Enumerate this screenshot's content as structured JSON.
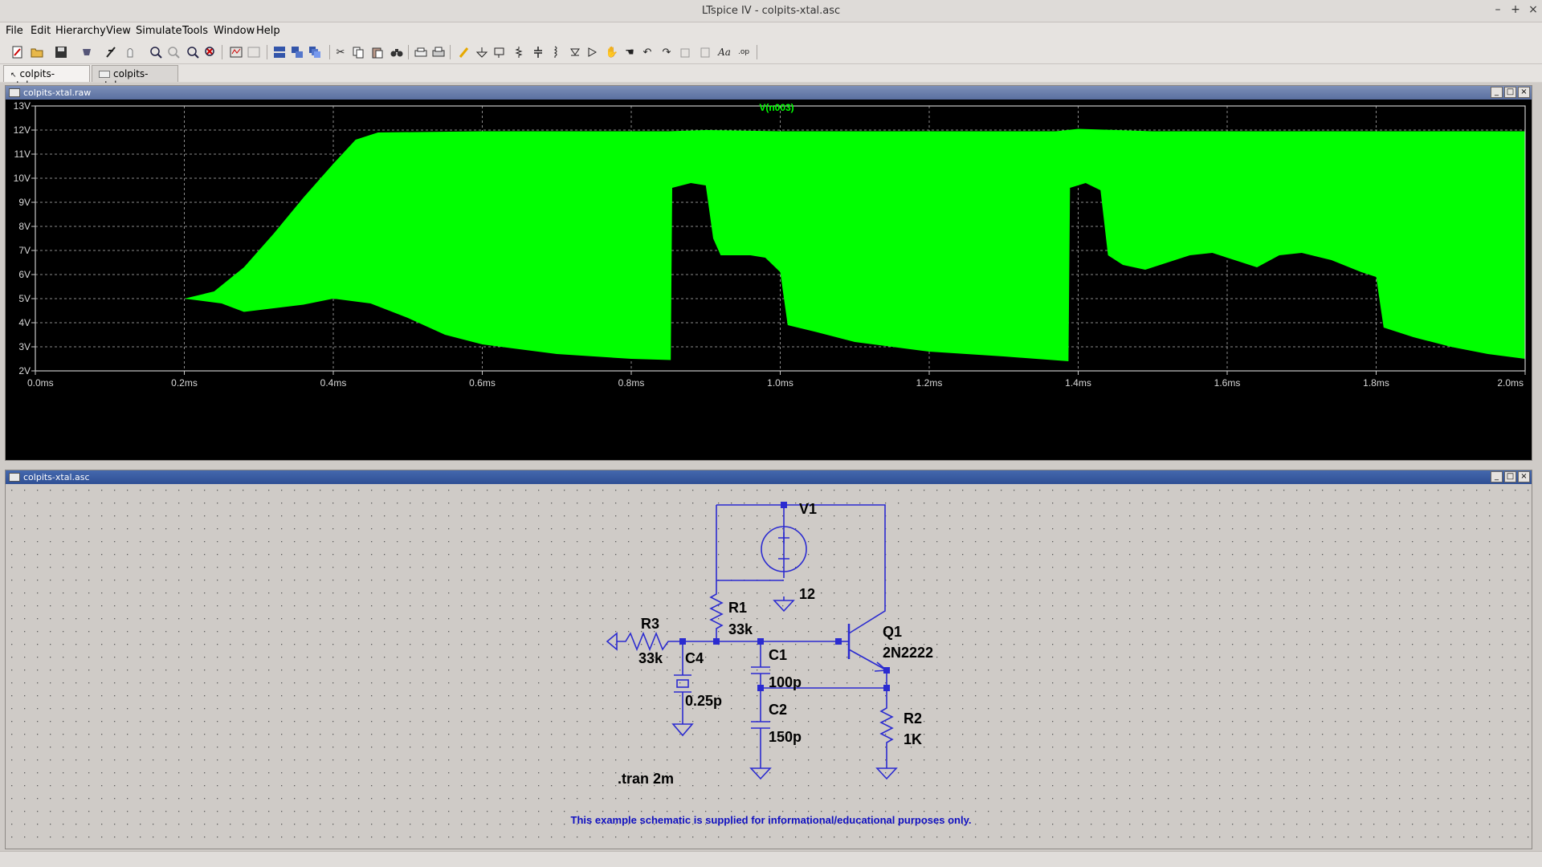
{
  "window": {
    "title": "LTspice IV - colpits-xtal.asc",
    "minimize": "–",
    "maximize": "+",
    "close": "×"
  },
  "menu": [
    "File",
    "Edit",
    "Hierarchy",
    "View",
    "Simulate",
    "Tools",
    "Window",
    "Help"
  ],
  "toolbar_icons": [
    "new-schematic-icon",
    "open-icon",
    "save-icon",
    "control-panel-icon",
    "run-icon",
    "halt-icon",
    "zoom-in-icon",
    "zoom-full-icon",
    "zoom-out-icon",
    "zoom-cancel-icon",
    "autorange-icon",
    "tile-horizontal-icon",
    "tile-vertical-icon",
    "cascade-icon",
    "cut-icon",
    "copy-icon",
    "paste-icon",
    "find-icon",
    "print-setup-icon",
    "print-icon",
    "wire-icon",
    "ground-icon",
    "label-net-icon",
    "resistor-icon",
    "capacitor-icon",
    "inductor-icon",
    "diode-icon",
    "component-icon",
    "move-icon",
    "drag-icon",
    "undo-icon",
    "redo-icon",
    "rotate-icon",
    "mirror-icon",
    "text-icon",
    "spice-directive-icon"
  ],
  "tabs": [
    {
      "label": "colpits-xtal.asc",
      "active": true
    },
    {
      "label": "colpits-xtal.raw",
      "active": false
    }
  ],
  "waveform_window": {
    "title": "colpits-xtal.raw",
    "trace_name": "V(n003)",
    "trace_color": "#00ff00",
    "background": "#000000",
    "button_labels": [
      "_",
      "□",
      "×"
    ]
  },
  "chart_data": {
    "type": "area",
    "title": "V(n003)",
    "xlabel": "",
    "ylabel": "",
    "xlim": [
      0.0,
      2.0
    ],
    "ylim": [
      2,
      13
    ],
    "x_ticks": [
      "0.0ms",
      "0.2ms",
      "0.4ms",
      "0.6ms",
      "0.8ms",
      "1.0ms",
      "1.2ms",
      "1.4ms",
      "1.6ms",
      "1.8ms",
      "2.0ms"
    ],
    "y_ticks": [
      "2V",
      "3V",
      "4V",
      "5V",
      "6V",
      "7V",
      "8V",
      "9V",
      "10V",
      "11V",
      "12V",
      "13V"
    ],
    "grid": true,
    "series": [
      {
        "name": "V(n003)",
        "x_ms": [
          0.0,
          0.2,
          0.24,
          0.28,
          0.32,
          0.36,
          0.4,
          0.43,
          0.46,
          0.6,
          0.8,
          0.85,
          0.9,
          1.0,
          1.2,
          1.37,
          1.4,
          1.5,
          1.7,
          1.8,
          2.0
        ],
        "upper_V": [
          5.0,
          5.0,
          5.3,
          6.3,
          7.7,
          9.2,
          10.6,
          11.6,
          11.9,
          11.95,
          11.95,
          11.95,
          12.0,
          11.95,
          11.95,
          11.95,
          12.05,
          11.95,
          11.95,
          11.95,
          11.95
        ],
        "lower_x_ms": [
          0.0,
          0.2,
          0.25,
          0.28,
          0.32,
          0.36,
          0.4,
          0.45,
          0.5,
          0.55,
          0.6,
          0.7,
          0.8,
          0.853,
          0.855,
          0.88,
          0.9,
          0.91,
          0.92,
          0.93,
          0.96,
          0.98,
          1.0,
          1.01,
          1.05,
          1.1,
          1.2,
          1.3,
          1.387,
          1.389,
          1.41,
          1.43,
          1.44,
          1.46,
          1.49,
          1.52,
          1.55,
          1.58,
          1.61,
          1.64,
          1.67,
          1.7,
          1.74,
          1.78,
          1.8,
          1.81,
          1.85,
          1.9,
          1.95,
          2.0
        ],
        "lower_V": [
          5.0,
          5.0,
          4.8,
          4.45,
          4.6,
          4.75,
          5.0,
          4.8,
          4.2,
          3.5,
          3.1,
          2.7,
          2.5,
          2.45,
          9.6,
          9.8,
          9.7,
          7.5,
          6.8,
          6.8,
          6.8,
          6.7,
          6.1,
          3.9,
          3.6,
          3.2,
          2.8,
          2.6,
          2.4,
          9.6,
          9.8,
          9.5,
          6.8,
          6.4,
          6.2,
          6.5,
          6.8,
          6.9,
          6.6,
          6.3,
          6.8,
          6.9,
          6.6,
          6.1,
          5.9,
          3.8,
          3.4,
          3.0,
          2.7,
          2.5
        ]
      }
    ]
  },
  "schematic_window": {
    "title": "colpits-xtal.asc",
    "wire_color": "#2b2bd0",
    "components": {
      "v1": {
        "name": "V1",
        "value": "12"
      },
      "r1": {
        "name": "R1",
        "value": "33k"
      },
      "r2": {
        "name": "R2",
        "value": "1K"
      },
      "r3": {
        "name": "R3",
        "value": "33k"
      },
      "c1": {
        "name": "C1",
        "value": "100p"
      },
      "c2": {
        "name": "C2",
        "value": "150p"
      },
      "c4": {
        "name": "C4",
        "value": "0.25p"
      },
      "q1": {
        "name": "Q1",
        "value": "2N2222"
      }
    },
    "directive": ".tran 2m",
    "note": "This example schematic is supplied for informational/educational purposes only."
  }
}
